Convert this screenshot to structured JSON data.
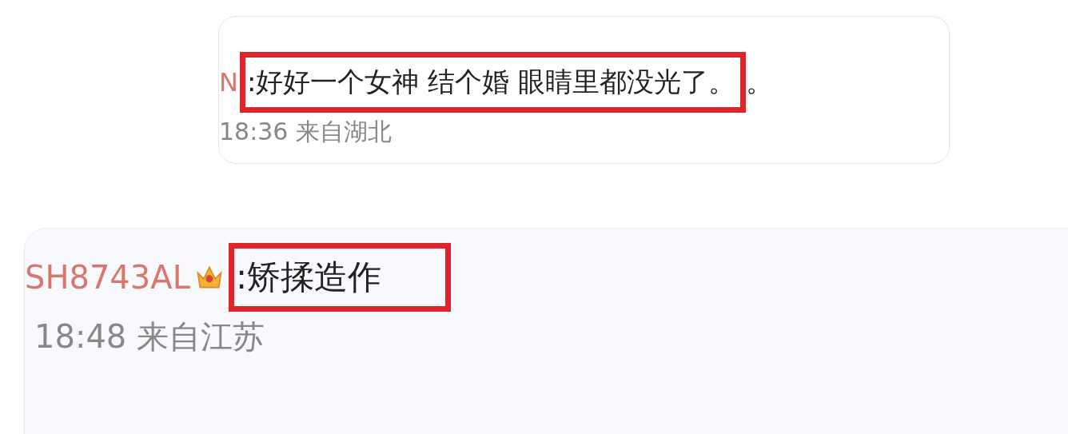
{
  "comments": [
    {
      "kind": "compact",
      "username": "N",
      "badge": false,
      "highlighted": true,
      "text": ":好好一个女神 结个婚 眼睛里都没光了。",
      "after": "。",
      "meta": "18:36 来自湖北"
    },
    {
      "kind": "large",
      "username": "SH8743AL",
      "badge": true,
      "highlighted": true,
      "text": ":矫揉造作",
      "meta": "18:48 来自江苏"
    }
  ]
}
